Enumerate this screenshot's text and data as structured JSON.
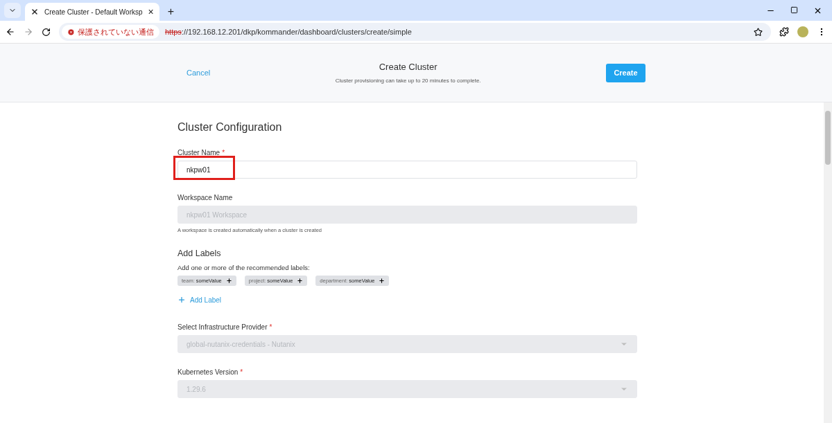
{
  "browser": {
    "tab_title": "Create Cluster - Default Worksp",
    "tab_close": "×",
    "new_tab": "+",
    "security_label": "保護されていない通信",
    "url_scheme": "https",
    "url_rest": "://192.168.12.201/dkp/kommander/dashboard/clusters/create/simple"
  },
  "header": {
    "cancel": "Cancel",
    "title": "Create Cluster",
    "subtitle": "Cluster provisioning can take up to 20 minutes to complete.",
    "create": "Create"
  },
  "form": {
    "title": "Cluster Configuration",
    "fields_top": [
      {
        "kind": "input",
        "label": "Cluster Name",
        "required_mark": "*",
        "value": "nkpw01",
        "disabled": false,
        "highlighted": true
      },
      {
        "kind": "input",
        "label": "Workspace Name",
        "value": "nkpw01 Workspace",
        "disabled": true,
        "hint": "A workspace is created automatically when a cluster is created"
      }
    ],
    "labels_section": {
      "title": "Add Labels",
      "description": "Add one or more of the recommended labels:",
      "chips": [
        {
          "key": "team:",
          "value": "someValue"
        },
        {
          "key": "project:",
          "value": "someValue"
        },
        {
          "key": "department:",
          "value": "someValue"
        }
      ],
      "add_label": "Add Label"
    },
    "fields_bottom": [
      {
        "kind": "select",
        "label": "Select Infrastructure Provider",
        "required_mark": "*",
        "value": "global-nutanix-credentials - Nutanix",
        "disabled": true
      },
      {
        "kind": "select",
        "label": "Kubernetes Version",
        "required_mark": "*",
        "value": "1.29.6",
        "disabled": true
      }
    ]
  }
}
